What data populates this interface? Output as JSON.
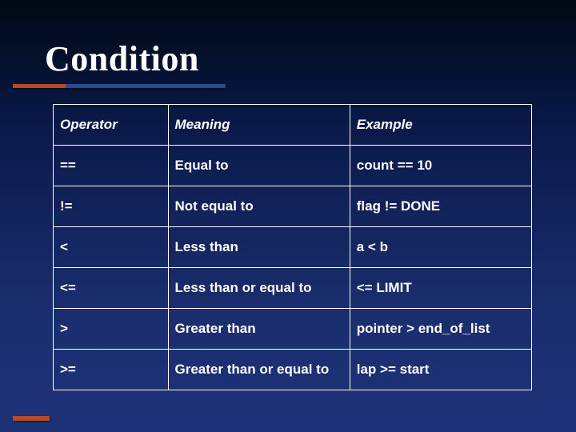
{
  "title": "Condition",
  "chart_data": {
    "type": "table",
    "headers": [
      "Operator",
      "Meaning",
      "Example"
    ],
    "rows": [
      [
        "==",
        "Equal to",
        "count == 10"
      ],
      [
        "!=",
        "Not equal to",
        "flag != DONE"
      ],
      [
        "<",
        "Less than",
        "a < b"
      ],
      [
        "<=",
        "Less than or equal to",
        "<= LIMIT"
      ],
      [
        ">",
        "Greater than",
        "pointer > end_of_list"
      ],
      [
        ">=",
        "Greater than or equal to",
        "lap >= start"
      ]
    ]
  }
}
